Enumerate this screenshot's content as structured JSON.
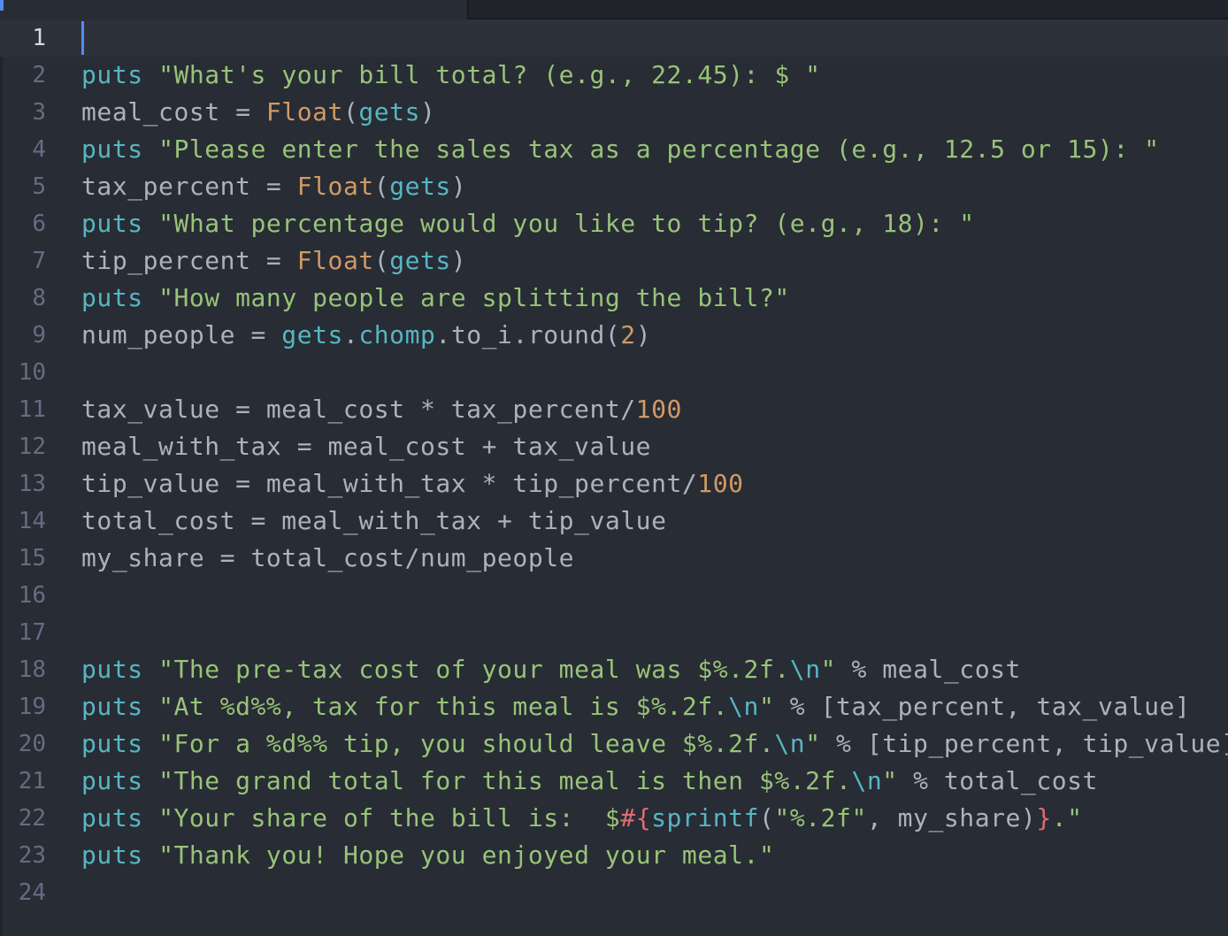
{
  "editor": {
    "cursor_line": 1,
    "lines": [
      {
        "n": "1",
        "t": [
          [
            "",
            ""
          ]
        ]
      },
      {
        "n": "2",
        "t": [
          [
            "kw",
            "puts"
          ],
          [
            "var",
            " "
          ],
          [
            "str",
            "\"What's your bill total? (e.g., 22.45): $ \""
          ]
        ]
      },
      {
        "n": "3",
        "t": [
          [
            "var",
            "meal_cost = "
          ],
          [
            "cls",
            "Float"
          ],
          [
            "var",
            "("
          ],
          [
            "kw",
            "gets"
          ],
          [
            "var",
            ")"
          ]
        ]
      },
      {
        "n": "4",
        "t": [
          [
            "kw",
            "puts"
          ],
          [
            "var",
            " "
          ],
          [
            "str",
            "\"Please enter the sales tax as a percentage (e.g., 12.5 or 15): \""
          ]
        ]
      },
      {
        "n": "5",
        "t": [
          [
            "var",
            "tax_percent = "
          ],
          [
            "cls",
            "Float"
          ],
          [
            "var",
            "("
          ],
          [
            "kw",
            "gets"
          ],
          [
            "var",
            ")"
          ]
        ]
      },
      {
        "n": "6",
        "t": [
          [
            "kw",
            "puts"
          ],
          [
            "var",
            " "
          ],
          [
            "str",
            "\"What percentage would you like to tip? (e.g., 18): \""
          ]
        ]
      },
      {
        "n": "7",
        "t": [
          [
            "var",
            "tip_percent = "
          ],
          [
            "cls",
            "Float"
          ],
          [
            "var",
            "("
          ],
          [
            "kw",
            "gets"
          ],
          [
            "var",
            ")"
          ]
        ]
      },
      {
        "n": "8",
        "t": [
          [
            "kw",
            "puts"
          ],
          [
            "var",
            " "
          ],
          [
            "str",
            "\"How many people are splitting the bill?\""
          ]
        ]
      },
      {
        "n": "9",
        "t": [
          [
            "var",
            "num_people = "
          ],
          [
            "kw",
            "gets"
          ],
          [
            "var",
            "."
          ],
          [
            "kw",
            "chomp"
          ],
          [
            "var",
            ".to_i.round("
          ],
          [
            "num",
            "2"
          ],
          [
            "var",
            ")"
          ]
        ]
      },
      {
        "n": "10",
        "t": [
          [
            "",
            ""
          ]
        ]
      },
      {
        "n": "11",
        "t": [
          [
            "var",
            "tax_value = meal_cost * tax_percent/"
          ],
          [
            "num",
            "100"
          ]
        ]
      },
      {
        "n": "12",
        "t": [
          [
            "var",
            "meal_with_tax = meal_cost + tax_value"
          ]
        ]
      },
      {
        "n": "13",
        "t": [
          [
            "var",
            "tip_value = meal_with_tax * tip_percent/"
          ],
          [
            "num",
            "100"
          ]
        ]
      },
      {
        "n": "14",
        "t": [
          [
            "var",
            "total_cost = meal_with_tax + tip_value"
          ]
        ]
      },
      {
        "n": "15",
        "t": [
          [
            "var",
            "my_share = total_cost/num_people"
          ]
        ]
      },
      {
        "n": "16",
        "t": [
          [
            "",
            ""
          ]
        ]
      },
      {
        "n": "17",
        "t": [
          [
            "",
            ""
          ]
        ]
      },
      {
        "n": "18",
        "t": [
          [
            "kw",
            "puts"
          ],
          [
            "var",
            " "
          ],
          [
            "str",
            "\"The pre-tax cost of your meal was $%.2f."
          ],
          [
            "esc",
            "\\n"
          ],
          [
            "str",
            "\""
          ],
          [
            "var",
            " % meal_cost"
          ]
        ]
      },
      {
        "n": "19",
        "t": [
          [
            "kw",
            "puts"
          ],
          [
            "var",
            " "
          ],
          [
            "str",
            "\"At %d%%, tax for this meal is $%.2f."
          ],
          [
            "esc",
            "\\n"
          ],
          [
            "str",
            "\""
          ],
          [
            "var",
            " % [tax_percent, tax_value]"
          ]
        ]
      },
      {
        "n": "20",
        "t": [
          [
            "kw",
            "puts"
          ],
          [
            "var",
            " "
          ],
          [
            "str",
            "\"For a %d%% tip, you should leave $%.2f."
          ],
          [
            "esc",
            "\\n"
          ],
          [
            "str",
            "\""
          ],
          [
            "var",
            " % [tip_percent, tip_value]"
          ]
        ]
      },
      {
        "n": "21",
        "t": [
          [
            "kw",
            "puts"
          ],
          [
            "var",
            " "
          ],
          [
            "str",
            "\"The grand total for this meal is then $%.2f."
          ],
          [
            "esc",
            "\\n"
          ],
          [
            "str",
            "\""
          ],
          [
            "var",
            " % total_cost"
          ]
        ]
      },
      {
        "n": "22",
        "t": [
          [
            "kw",
            "puts"
          ],
          [
            "var",
            " "
          ],
          [
            "str",
            "\"Your share of the bill is:  $"
          ],
          [
            "interp",
            "#{"
          ],
          [
            "kw",
            "sprintf"
          ],
          [
            "var",
            "("
          ],
          [
            "str",
            "\"%.2f\""
          ],
          [
            "var",
            ", my_share)"
          ],
          [
            "interp",
            "}"
          ],
          [
            "str",
            ".\""
          ]
        ]
      },
      {
        "n": "23",
        "t": [
          [
            "kw",
            "puts"
          ],
          [
            "var",
            " "
          ],
          [
            "str",
            "\"Thank you! Hope you enjoyed your meal.\""
          ]
        ]
      },
      {
        "n": "24",
        "t": [
          [
            "",
            ""
          ]
        ]
      }
    ]
  }
}
